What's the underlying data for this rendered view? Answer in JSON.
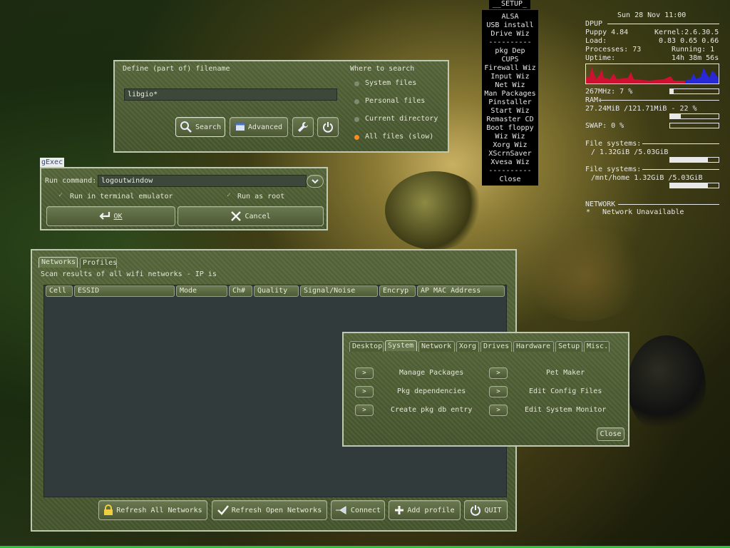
{
  "find_window": {
    "define_label": "Define (part of) filename",
    "search_value": "libgio*",
    "where_label": "Where to search",
    "options": [
      {
        "label": "System files",
        "selected": false
      },
      {
        "label": "Personal files",
        "selected": false
      },
      {
        "label": "Current directory",
        "selected": false
      },
      {
        "label": "All files (slow)",
        "selected": true
      }
    ],
    "search_button": "Search",
    "advanced_button": "Advanced"
  },
  "gexec": {
    "title": "gExec",
    "run_label": "Run command:",
    "command": "logoutwindow",
    "terminal_label": "Run in terminal emulator",
    "root_label": "Run as root",
    "ok_button": "OK",
    "cancel_button": "Cancel"
  },
  "wifi": {
    "tabs": [
      "Networks",
      "Profiles"
    ],
    "scan_text": "Scan results of all wifi networks -  IP is",
    "columns": [
      "Cell",
      "ESSID",
      "Mode",
      "Ch#",
      "Quality",
      "Signal/Noise",
      "Encryp",
      "AP MAC Address"
    ],
    "buttons": {
      "refresh_all": "Refresh All Networks",
      "refresh_open": "Refresh Open Networks",
      "connect": "Connect",
      "add_profile": "Add profile",
      "quit": "QUIT"
    }
  },
  "setup_menu": {
    "title": "__SETUP_",
    "items": [
      "ALSA",
      "USB install",
      "Drive Wiz",
      "----------",
      "pkg Dep",
      "CUPS",
      "Firewall Wiz",
      "Input Wiz",
      "Net Wiz",
      "Man Packages",
      "Pinstaller",
      "Start Wiz",
      "Remaster CD",
      "Boot floppy",
      "Wiz Wiz",
      "Xorg Wiz",
      "XScrnSaver",
      "Xvesa Wiz",
      "----------",
      "Close"
    ]
  },
  "conky": {
    "datetime": "Sun 28 Nov 11:00",
    "section": "DPUP",
    "os": "Puppy 4.84",
    "kernel": "Kernel:2.6.30.5",
    "load_label": "Load:",
    "load": "0.83 0.65 0.66",
    "processes": "Processes: 73",
    "running": "Running: 1",
    "uptime_label": "Uptime:",
    "uptime": "14h 38m 56s",
    "cpu": "267MHz: 7  %",
    "cpu_fraction": 0.07,
    "ram_label": "RAM:",
    "ram": "27.24MiB /121.71MiB - 22 %",
    "ram_fraction": 0.22,
    "swap": "SWAP: 0  %",
    "swap_fraction": 0.0,
    "fs_label": "File systems:",
    "fs_root": "/ 1.32GiB  /5.03GiB",
    "fs_root_fraction": 0.78,
    "fs_label2": "File systems:",
    "fs_home": "/mnt/home 1.32GiB  /5.03GiB",
    "fs_home_fraction": 0.78,
    "network_label": "NETWORK",
    "network_status": "Network Unavailable",
    "network_marker": "*"
  },
  "control_panel": {
    "tabs": [
      "Desktop",
      "System",
      "Network",
      "Xorg",
      "Drives",
      "Hardware",
      "Setup",
      "Misc."
    ],
    "active_tab": "System",
    "row_items": [
      [
        "Manage Packages",
        "Pet Maker"
      ],
      [
        "Pkg dependencies",
        "Edit Config Files"
      ],
      [
        "Create pkg db entry",
        "Edit System Monitor"
      ]
    ],
    "arrow": ">",
    "close_button": "Close"
  },
  "colors": {
    "radio_selected": "#ff8a1e",
    "cpu_graph_red": "#d01030",
    "cpu_graph_blue": "#2828d8",
    "taskbar": "#27c33a"
  }
}
